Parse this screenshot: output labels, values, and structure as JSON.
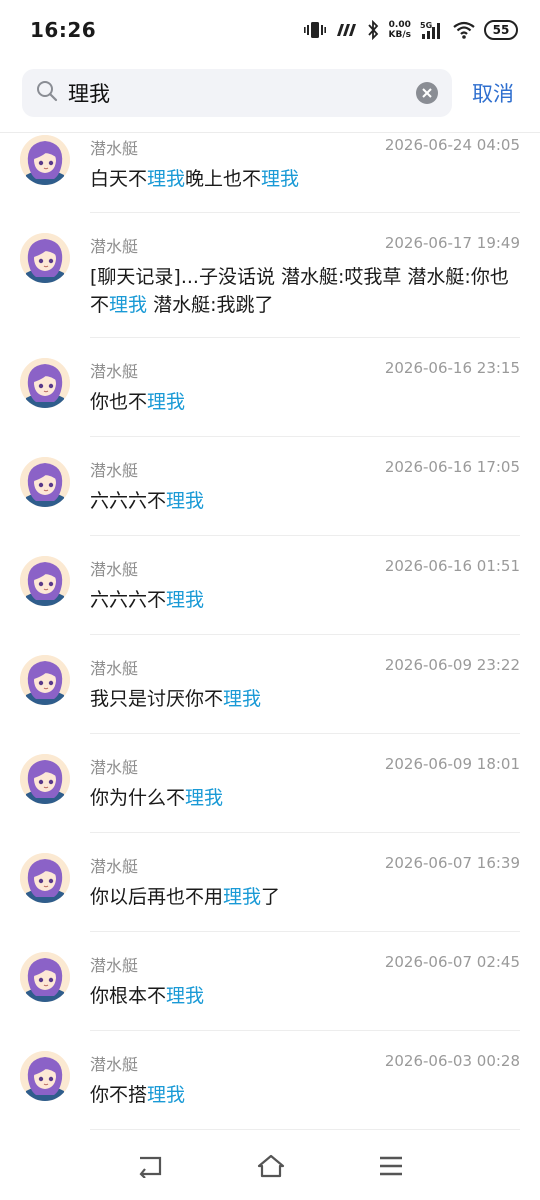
{
  "status": {
    "time": "16:26",
    "net_speed_value": "0.00",
    "net_speed_unit": "KB/s",
    "network": "5G",
    "battery": "55"
  },
  "search": {
    "query": "理我",
    "cancel_label": "取消"
  },
  "results": [
    {
      "name": "潜水艇",
      "time": "2026-06-24 04:05",
      "parts": [
        {
          "t": "白天不"
        },
        {
          "t": "理我",
          "h": true
        },
        {
          "t": "晚上也不"
        },
        {
          "t": "理我",
          "h": true
        }
      ]
    },
    {
      "name": "潜水艇",
      "time": "2026-06-17 19:49",
      "parts": [
        {
          "t": "[聊天记录]...子没话说 潜水艇:哎我草 潜水艇:你也不"
        },
        {
          "t": "理我",
          "h": true
        },
        {
          "t": " 潜水艇:我跳了"
        }
      ]
    },
    {
      "name": "潜水艇",
      "time": "2026-06-16 23:15",
      "parts": [
        {
          "t": "你也不"
        },
        {
          "t": "理我",
          "h": true
        }
      ]
    },
    {
      "name": "潜水艇",
      "time": "2026-06-16 17:05",
      "parts": [
        {
          "t": "六六六不"
        },
        {
          "t": "理我",
          "h": true
        }
      ]
    },
    {
      "name": "潜水艇",
      "time": "2026-06-16 01:51",
      "parts": [
        {
          "t": "六六六不"
        },
        {
          "t": "理我",
          "h": true
        }
      ]
    },
    {
      "name": "潜水艇",
      "time": "2026-06-09 23:22",
      "parts": [
        {
          "t": "我只是讨厌你不"
        },
        {
          "t": "理我",
          "h": true
        }
      ]
    },
    {
      "name": "潜水艇",
      "time": "2026-06-09 18:01",
      "parts": [
        {
          "t": "你为什么不"
        },
        {
          "t": "理我",
          "h": true
        }
      ]
    },
    {
      "name": "潜水艇",
      "time": "2026-06-07 16:39",
      "parts": [
        {
          "t": "你以后再也不用"
        },
        {
          "t": "理我",
          "h": true
        },
        {
          "t": "了"
        }
      ]
    },
    {
      "name": "潜水艇",
      "time": "2026-06-07 02:45",
      "parts": [
        {
          "t": "你根本不"
        },
        {
          "t": "理我",
          "h": true
        }
      ]
    },
    {
      "name": "潜水艇",
      "time": "2026-06-03 00:28",
      "parts": [
        {
          "t": "你不搭"
        },
        {
          "t": "理我",
          "h": true
        }
      ]
    }
  ],
  "colors": {
    "highlight": "#1a9ad6",
    "cancel": "#2f6fcf",
    "search_bg": "#f2f3f7"
  },
  "icons": {
    "search": "search-icon",
    "clear": "clear-icon",
    "back": "back-nav-icon",
    "home": "home-nav-icon",
    "menu": "menu-nav-icon"
  }
}
